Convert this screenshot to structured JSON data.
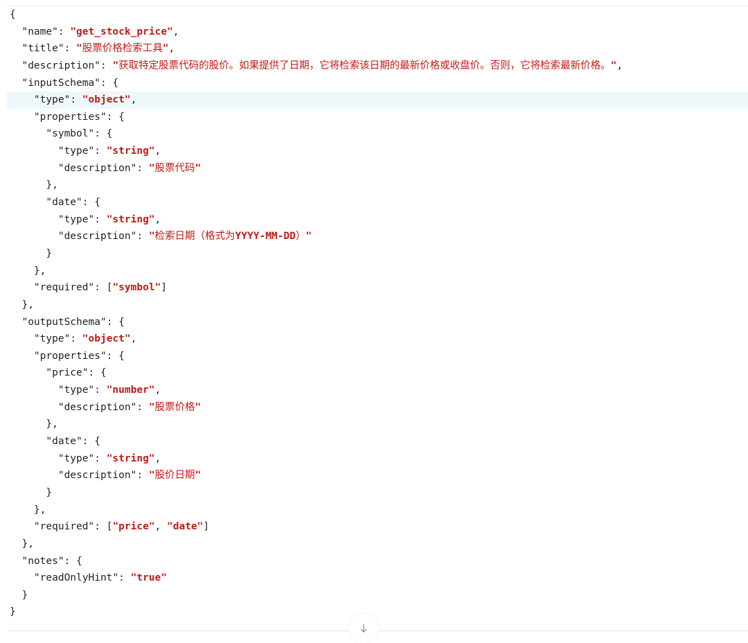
{
  "code_lines": [
    [
      {
        "t": "p",
        "v": "{"
      }
    ],
    [
      {
        "t": "p",
        "v": "  "
      },
      {
        "t": "k",
        "v": "\"name\""
      },
      {
        "t": "p",
        "v": ": "
      },
      {
        "t": "s",
        "v": "\"get_stock_price\""
      },
      {
        "t": "p",
        "v": ","
      }
    ],
    [
      {
        "t": "p",
        "v": "  "
      },
      {
        "t": "k",
        "v": "\"title\""
      },
      {
        "t": "p",
        "v": ": "
      },
      {
        "t": "s",
        "v": "\""
      },
      {
        "t": "c",
        "v": "股票价格检索工具"
      },
      {
        "t": "s",
        "v": "\""
      },
      {
        "t": "p",
        "v": ","
      }
    ],
    [
      {
        "t": "p",
        "v": "  "
      },
      {
        "t": "k",
        "v": "\"description\""
      },
      {
        "t": "p",
        "v": ": "
      },
      {
        "t": "s",
        "v": "\""
      },
      {
        "t": "c",
        "v": "获取特定股票代码的股价。如果提供了日期，它将检索该日期的最新价格或收盘价。否则，它将检索最新价格。"
      },
      {
        "t": "s",
        "v": "\""
      },
      {
        "t": "p",
        "v": ","
      }
    ],
    [
      {
        "t": "p",
        "v": "  "
      },
      {
        "t": "k",
        "v": "\"inputSchema\""
      },
      {
        "t": "p",
        "v": ": {"
      }
    ],
    [
      {
        "t": "p",
        "v": "    "
      },
      {
        "t": "k",
        "v": "\"type\""
      },
      {
        "t": "p",
        "v": ": "
      },
      {
        "t": "s",
        "v": "\"object\""
      },
      {
        "t": "p",
        "v": ","
      }
    ],
    [
      {
        "t": "p",
        "v": "    "
      },
      {
        "t": "k",
        "v": "\"properties\""
      },
      {
        "t": "p",
        "v": ": {"
      }
    ],
    [
      {
        "t": "p",
        "v": "      "
      },
      {
        "t": "k",
        "v": "\"symbol\""
      },
      {
        "t": "p",
        "v": ": {"
      }
    ],
    [
      {
        "t": "p",
        "v": "        "
      },
      {
        "t": "k",
        "v": "\"type\""
      },
      {
        "t": "p",
        "v": ": "
      },
      {
        "t": "s",
        "v": "\"string\""
      },
      {
        "t": "p",
        "v": ","
      }
    ],
    [
      {
        "t": "p",
        "v": "        "
      },
      {
        "t": "k",
        "v": "\"description\""
      },
      {
        "t": "p",
        "v": ": "
      },
      {
        "t": "s",
        "v": "\""
      },
      {
        "t": "c",
        "v": "股票代码"
      },
      {
        "t": "s",
        "v": "\""
      }
    ],
    [
      {
        "t": "p",
        "v": "      },"
      }
    ],
    [
      {
        "t": "p",
        "v": "      "
      },
      {
        "t": "k",
        "v": "\"date\""
      },
      {
        "t": "p",
        "v": ": {"
      }
    ],
    [
      {
        "t": "p",
        "v": "        "
      },
      {
        "t": "k",
        "v": "\"type\""
      },
      {
        "t": "p",
        "v": ": "
      },
      {
        "t": "s",
        "v": "\"string\""
      },
      {
        "t": "p",
        "v": ","
      }
    ],
    [
      {
        "t": "p",
        "v": "        "
      },
      {
        "t": "k",
        "v": "\"description\""
      },
      {
        "t": "p",
        "v": ": "
      },
      {
        "t": "s",
        "v": "\""
      },
      {
        "t": "c",
        "v": "检索日期（格式为"
      },
      {
        "t": "s",
        "v": "YYYY-MM-DD"
      },
      {
        "t": "c",
        "v": "）"
      },
      {
        "t": "s",
        "v": "\""
      }
    ],
    [
      {
        "t": "p",
        "v": "      }"
      }
    ],
    [
      {
        "t": "p",
        "v": "    },"
      }
    ],
    [
      {
        "t": "p",
        "v": "    "
      },
      {
        "t": "k",
        "v": "\"required\""
      },
      {
        "t": "p",
        "v": ": ["
      },
      {
        "t": "s",
        "v": "\"symbol\""
      },
      {
        "t": "p",
        "v": "]"
      }
    ],
    [
      {
        "t": "p",
        "v": "  },"
      }
    ],
    [
      {
        "t": "p",
        "v": "  "
      },
      {
        "t": "k",
        "v": "\"outputSchema\""
      },
      {
        "t": "p",
        "v": ": {"
      }
    ],
    [
      {
        "t": "p",
        "v": "    "
      },
      {
        "t": "k",
        "v": "\"type\""
      },
      {
        "t": "p",
        "v": ": "
      },
      {
        "t": "s",
        "v": "\"object\""
      },
      {
        "t": "p",
        "v": ","
      }
    ],
    [
      {
        "t": "p",
        "v": "    "
      },
      {
        "t": "k",
        "v": "\"properties\""
      },
      {
        "t": "p",
        "v": ": {"
      }
    ],
    [
      {
        "t": "p",
        "v": "      "
      },
      {
        "t": "k",
        "v": "\"price\""
      },
      {
        "t": "p",
        "v": ": {"
      }
    ],
    [
      {
        "t": "p",
        "v": "        "
      },
      {
        "t": "k",
        "v": "\"type\""
      },
      {
        "t": "p",
        "v": ": "
      },
      {
        "t": "s",
        "v": "\"number\""
      },
      {
        "t": "p",
        "v": ","
      }
    ],
    [
      {
        "t": "p",
        "v": "        "
      },
      {
        "t": "k",
        "v": "\"description\""
      },
      {
        "t": "p",
        "v": ": "
      },
      {
        "t": "s",
        "v": "\""
      },
      {
        "t": "c",
        "v": "股票价格"
      },
      {
        "t": "s",
        "v": "\""
      }
    ],
    [
      {
        "t": "p",
        "v": "      },"
      }
    ],
    [
      {
        "t": "p",
        "v": "      "
      },
      {
        "t": "k",
        "v": "\"date\""
      },
      {
        "t": "p",
        "v": ": {"
      }
    ],
    [
      {
        "t": "p",
        "v": "        "
      },
      {
        "t": "k",
        "v": "\"type\""
      },
      {
        "t": "p",
        "v": ": "
      },
      {
        "t": "s",
        "v": "\"string\""
      },
      {
        "t": "p",
        "v": ","
      }
    ],
    [
      {
        "t": "p",
        "v": "        "
      },
      {
        "t": "k",
        "v": "\"description\""
      },
      {
        "t": "p",
        "v": ": "
      },
      {
        "t": "s",
        "v": "\""
      },
      {
        "t": "c",
        "v": "股价日期"
      },
      {
        "t": "s",
        "v": "\""
      }
    ],
    [
      {
        "t": "p",
        "v": "      }"
      }
    ],
    [
      {
        "t": "p",
        "v": "    },"
      }
    ],
    [
      {
        "t": "p",
        "v": "    "
      },
      {
        "t": "k",
        "v": "\"required\""
      },
      {
        "t": "p",
        "v": ": ["
      },
      {
        "t": "s",
        "v": "\"price\""
      },
      {
        "t": "p",
        "v": ", "
      },
      {
        "t": "s",
        "v": "\"date\""
      },
      {
        "t": "p",
        "v": "]"
      }
    ],
    [
      {
        "t": "p",
        "v": "  },"
      }
    ],
    [
      {
        "t": "p",
        "v": "  "
      },
      {
        "t": "k",
        "v": "\"notes\""
      },
      {
        "t": "p",
        "v": ": {"
      }
    ],
    [
      {
        "t": "p",
        "v": "    "
      },
      {
        "t": "k",
        "v": "\"readOnlyHint\""
      },
      {
        "t": "p",
        "v": ": "
      },
      {
        "t": "s",
        "v": "\"true\""
      }
    ],
    [
      {
        "t": "p",
        "v": "  }"
      }
    ],
    [
      {
        "t": "p",
        "v": "}"
      }
    ]
  ],
  "highlighted_line": 5,
  "colors": {
    "string": "#c41a16",
    "text": "#1f1f1f",
    "highlight_bg": "#eef7fc"
  },
  "scroll_handle": {
    "icon": "arrow-down-icon"
  }
}
